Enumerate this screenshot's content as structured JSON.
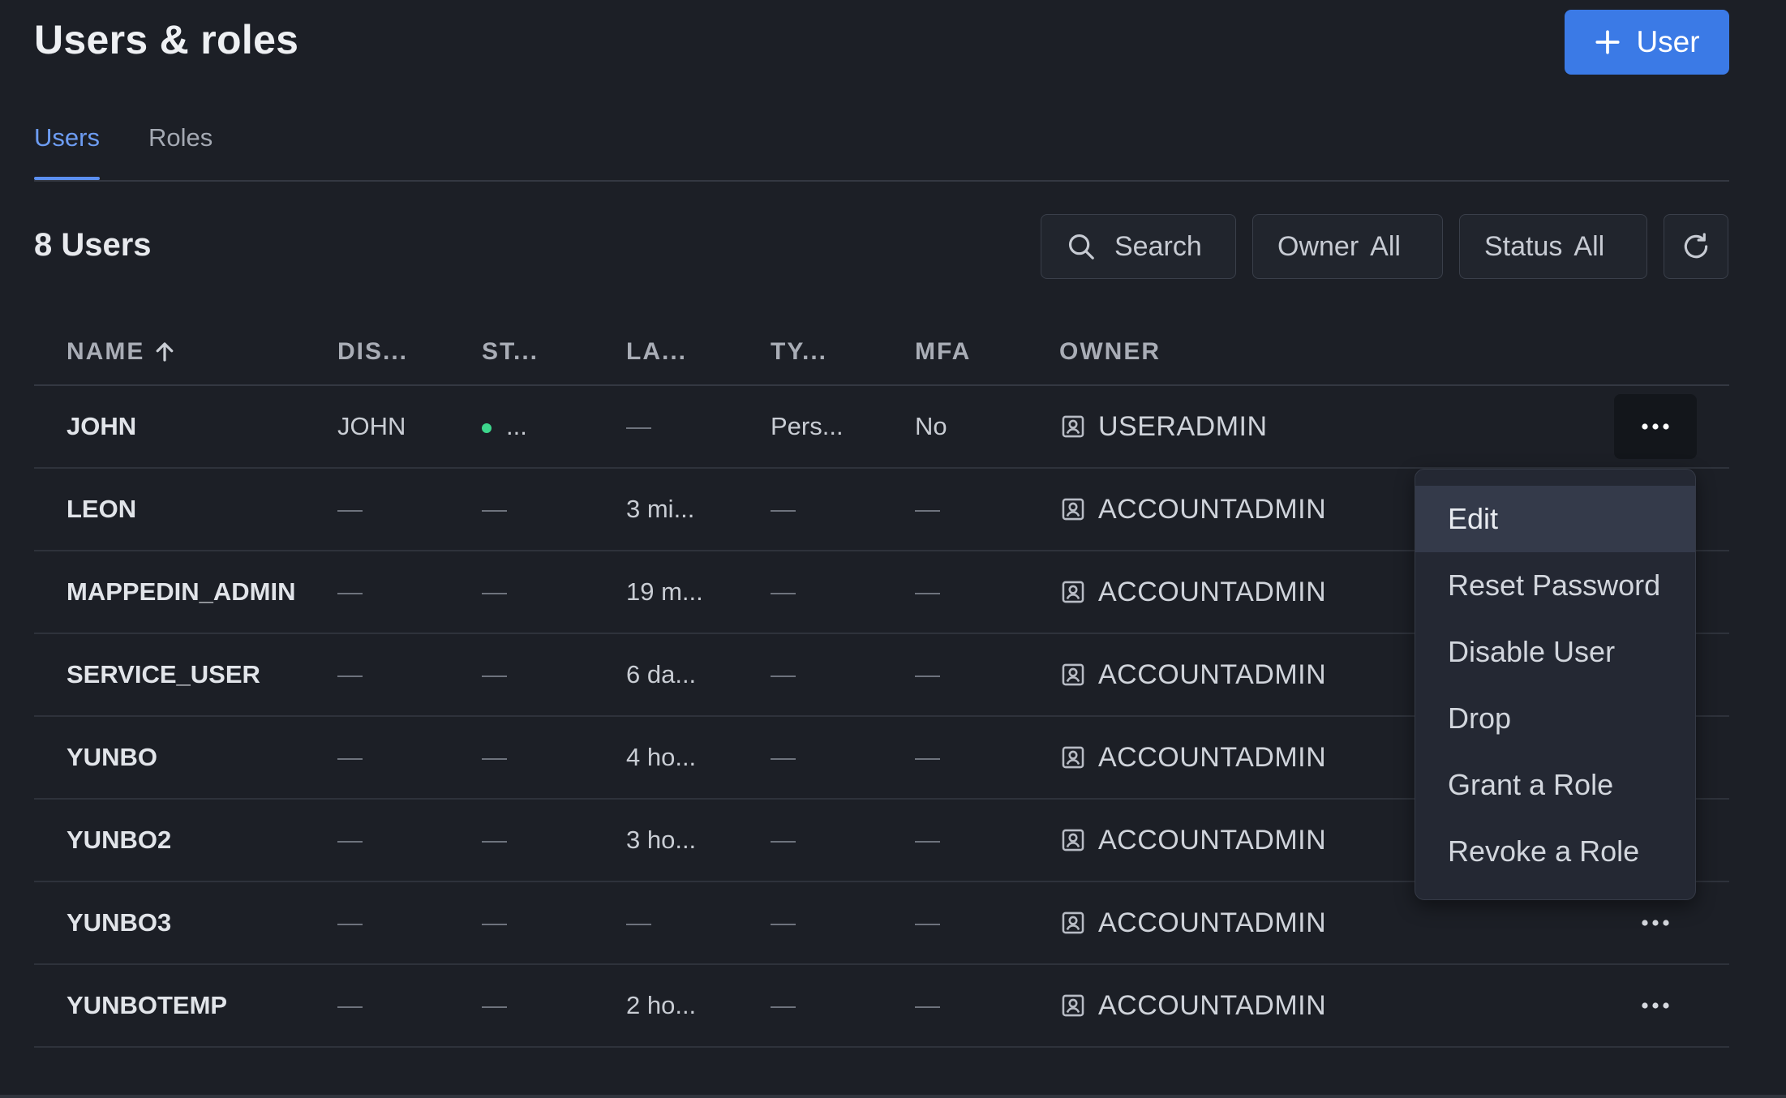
{
  "header": {
    "title": "Users & roles",
    "add_user_label": "User"
  },
  "tabs": [
    {
      "label": "Users",
      "active": true
    },
    {
      "label": "Roles",
      "active": false
    }
  ],
  "toolbar": {
    "count_label": "8 Users",
    "search_label": "Search",
    "owner_label": "Owner",
    "owner_value": "All",
    "status_label": "Status",
    "status_value": "All"
  },
  "table": {
    "columns": [
      "NAME",
      "DIS...",
      "ST...",
      "LA...",
      "TY...",
      "MFA",
      "OWNER"
    ],
    "sort": {
      "column": "NAME",
      "direction": "asc"
    },
    "rows": [
      {
        "name": "JOHN",
        "dis": "JOHN",
        "st": "...",
        "la": "—",
        "ty": "Pers...",
        "mfa": "No",
        "owner": "USERADMIN"
      },
      {
        "name": "LEON",
        "dis": "—",
        "st": "—",
        "la": "3 mi...",
        "ty": "—",
        "mfa": "—",
        "owner": "ACCOUNTADMIN"
      },
      {
        "name": "MAPPEDIN_ADMIN",
        "dis": "—",
        "st": "—",
        "la": "19 m...",
        "ty": "—",
        "mfa": "—",
        "owner": "ACCOUNTADMIN"
      },
      {
        "name": "SERVICE_USER",
        "dis": "—",
        "st": "—",
        "la": "6 da...",
        "ty": "—",
        "mfa": "—",
        "owner": "ACCOUNTADMIN"
      },
      {
        "name": "YUNBO",
        "dis": "—",
        "st": "—",
        "la": "4 ho...",
        "ty": "—",
        "mfa": "—",
        "owner": "ACCOUNTADMIN"
      },
      {
        "name": "YUNBO2",
        "dis": "—",
        "st": "—",
        "la": "3 ho...",
        "ty": "—",
        "mfa": "—",
        "owner": "ACCOUNTADMIN"
      },
      {
        "name": "YUNBO3",
        "dis": "—",
        "st": "—",
        "la": "—",
        "ty": "—",
        "mfa": "—",
        "owner": "ACCOUNTADMIN"
      },
      {
        "name": "YUNBOTEMP",
        "dis": "—",
        "st": "—",
        "la": "2 ho...",
        "ty": "—",
        "mfa": "—",
        "owner": "ACCOUNTADMIN"
      }
    ]
  },
  "row_menu": {
    "items": [
      "Edit",
      "Reset Password",
      "Disable User",
      "Drop",
      "Grant a Role",
      "Revoke a Role"
    ],
    "highlighted": "Edit"
  },
  "colors": {
    "background": "#1c1f26",
    "accent": "#3b7ae6",
    "active_tab": "#6d9cf2",
    "status_active": "#3dd68c"
  },
  "icons": {
    "add": "plus-icon",
    "search": "search-icon",
    "refresh": "refresh-icon",
    "sort": "arrow-up-icon",
    "owner": "role-badge-icon",
    "row_actions": "more-horizontal-icon"
  }
}
